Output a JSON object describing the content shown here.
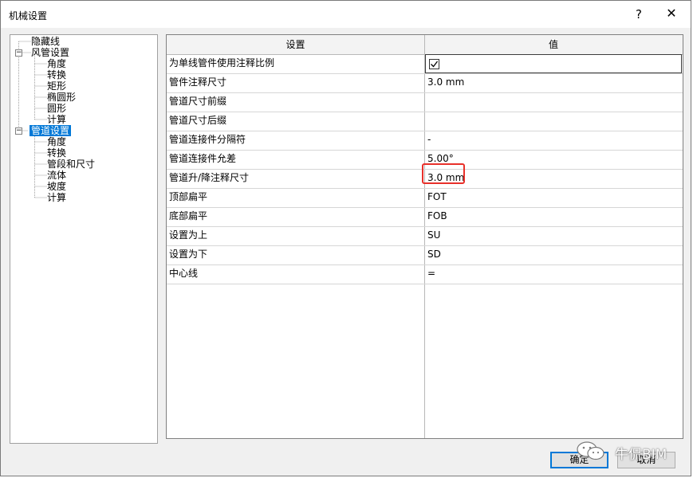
{
  "window": {
    "title": "机械设置",
    "help": "?",
    "close": "✕"
  },
  "tree": {
    "items": [
      {
        "label": "隐藏线",
        "level": 0
      },
      {
        "label": "风管设置",
        "level": 0,
        "expander": "−"
      },
      {
        "label": "角度",
        "level": 1
      },
      {
        "label": "转换",
        "level": 1
      },
      {
        "label": "矩形",
        "level": 1
      },
      {
        "label": "椭圆形",
        "level": 1
      },
      {
        "label": "圆形",
        "level": 1
      },
      {
        "label": "计算",
        "level": 1
      },
      {
        "label": "管道设置",
        "level": 0,
        "expander": "−",
        "selected": true
      },
      {
        "label": "角度",
        "level": 1
      },
      {
        "label": "转换",
        "level": 1
      },
      {
        "label": "管段和尺寸",
        "level": 1
      },
      {
        "label": "流体",
        "level": 1
      },
      {
        "label": "坡度",
        "level": 1
      },
      {
        "label": "计算",
        "level": 1
      }
    ]
  },
  "grid": {
    "headers": {
      "setting": "设置",
      "value": "值"
    },
    "rows": [
      {
        "setting": "为单线管件使用注释比例",
        "value": "",
        "checkbox": true,
        "checked": true
      },
      {
        "setting": "管件注释尺寸",
        "value": "3.0 mm"
      },
      {
        "setting": "管道尺寸前缀",
        "value": ""
      },
      {
        "setting": "管道尺寸后缀",
        "value": ""
      },
      {
        "setting": "管道连接件分隔符",
        "value": "-"
      },
      {
        "setting": "管道连接件允差",
        "value": "5.00°"
      },
      {
        "setting": "管道升/降注释尺寸",
        "value": "3.0 mm",
        "highlighted": true
      },
      {
        "setting": "顶部扁平",
        "value": "FOT"
      },
      {
        "setting": "底部扁平",
        "value": "FOB"
      },
      {
        "setting": "设置为上",
        "value": "SU"
      },
      {
        "setting": "设置为下",
        "value": "SD"
      },
      {
        "setting": "中心线",
        "value": "="
      }
    ]
  },
  "buttons": {
    "ok": "确定",
    "cancel": "取消"
  },
  "watermark": {
    "text": "牛侃BIM"
  },
  "colors": {
    "selection": "#0078d7",
    "highlight_border": "#e8302a"
  }
}
